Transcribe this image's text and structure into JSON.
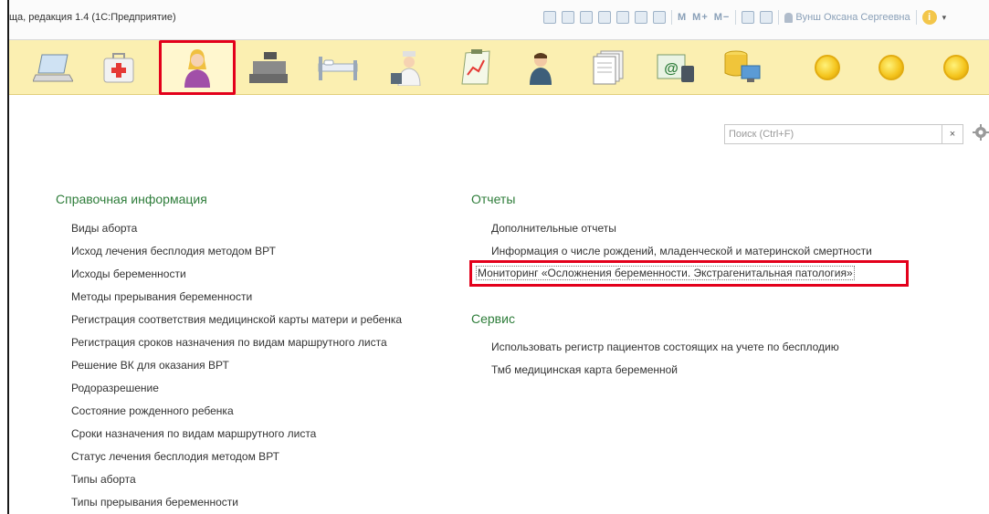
{
  "window": {
    "title": "ща, редакция 1.4  (1С:Предприятие)"
  },
  "toolbar": {
    "memory_labels": [
      "M",
      "M+",
      "M−"
    ],
    "user_name": "Вунш Оксана Сергеевна"
  },
  "sections": {
    "icons": [
      "laptop-icon",
      "first-aid-kit-icon",
      "woman-icon",
      "cash-register-icon",
      "hospital-bed-icon",
      "doctor-icon",
      "report-chart-icon",
      "man-icon",
      "documents-icon",
      "email-icon",
      "database-icon",
      "circle-icon",
      "circle-icon",
      "circle-icon"
    ],
    "active_index": 2,
    "highlight_color": "#e3001b"
  },
  "search": {
    "placeholder": "Поиск (Ctrl+F)",
    "value": "",
    "clear_label": "×"
  },
  "reference": {
    "title": "Справочная информация",
    "items": [
      "Виды аборта",
      "Исход лечения бесплодия методом ВРТ",
      "Исходы беременности",
      "Методы прерывания беременности",
      "Регистрация соответствия медицинской карты матери и ребенка",
      "Регистрация сроков назначения по видам маршрутного листа",
      "Решение ВК для оказания ВРТ",
      "Родоразрешение",
      "Состояние рожденного ребенка",
      "Сроки назначения по видам маршрутного листа",
      "Статус лечения бесплодия методом ВРТ",
      "Типы аборта",
      "Типы прерывания беременности"
    ]
  },
  "reports": {
    "title": "Отчеты",
    "items": [
      "Дополнительные отчеты",
      "Информация о числе рождений, младенческой и материнской смертности",
      "Мониторинг «Осложнения беременности. Экстрагенитальная патология»"
    ]
  },
  "service": {
    "title": "Сервис",
    "items": [
      "Использовать регистр пациентов состоящих на учете по бесплодию",
      "Тмб медицинская карта беременной"
    ]
  },
  "colors": {
    "group_title": "#2e7d3a",
    "sections_bg": "#fbefb1",
    "link": "#333333"
  }
}
